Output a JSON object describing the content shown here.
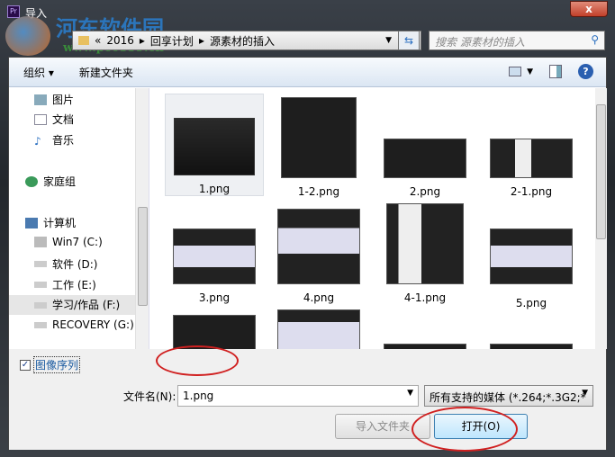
{
  "window": {
    "title": "导入",
    "close": "x",
    "app_icon": "Pr"
  },
  "watermark": {
    "name": "河东软件园",
    "url": "www.pc0359.cn"
  },
  "address": {
    "parts": [
      "«",
      "2016",
      "▸",
      "回享计划",
      "▸",
      "源素材的插入"
    ],
    "search_placeholder": "搜索 源素材的插入"
  },
  "toolbar": {
    "organize": "组织 ▾",
    "new_folder": "新建文件夹"
  },
  "sidebar": {
    "items": [
      {
        "label": "图片",
        "icon": "pictures-icon"
      },
      {
        "label": "文档",
        "icon": "documents-icon"
      },
      {
        "label": "音乐",
        "icon": "music-icon"
      },
      {
        "label": "家庭组",
        "icon": "homegroup-icon"
      },
      {
        "label": "计算机",
        "icon": "computer-icon"
      },
      {
        "label": "Win7 (C:)",
        "icon": "drive-icon"
      },
      {
        "label": "软件 (D:)",
        "icon": "drive-icon"
      },
      {
        "label": "工作 (E:)",
        "icon": "drive-icon"
      },
      {
        "label": "学习/作品 (F:)",
        "icon": "drive-icon"
      },
      {
        "label": "RECOVERY (G:)",
        "icon": "drive-icon"
      }
    ]
  },
  "files": [
    {
      "name": "1.png"
    },
    {
      "name": "1-2.png"
    },
    {
      "name": "2.png"
    },
    {
      "name": "2-1.png"
    },
    {
      "name": "3.png"
    },
    {
      "name": "4.png"
    },
    {
      "name": "4-1.png"
    },
    {
      "name": "5.png"
    }
  ],
  "bottom": {
    "image_sequence": "图像序列",
    "image_sequence_checked": true,
    "filename_label": "文件名(N):",
    "filename": "1.png",
    "filetype": "所有支持的媒体 (*.264;*.3G2;*",
    "import_folder": "导入文件夹",
    "open": "打开(O)"
  }
}
